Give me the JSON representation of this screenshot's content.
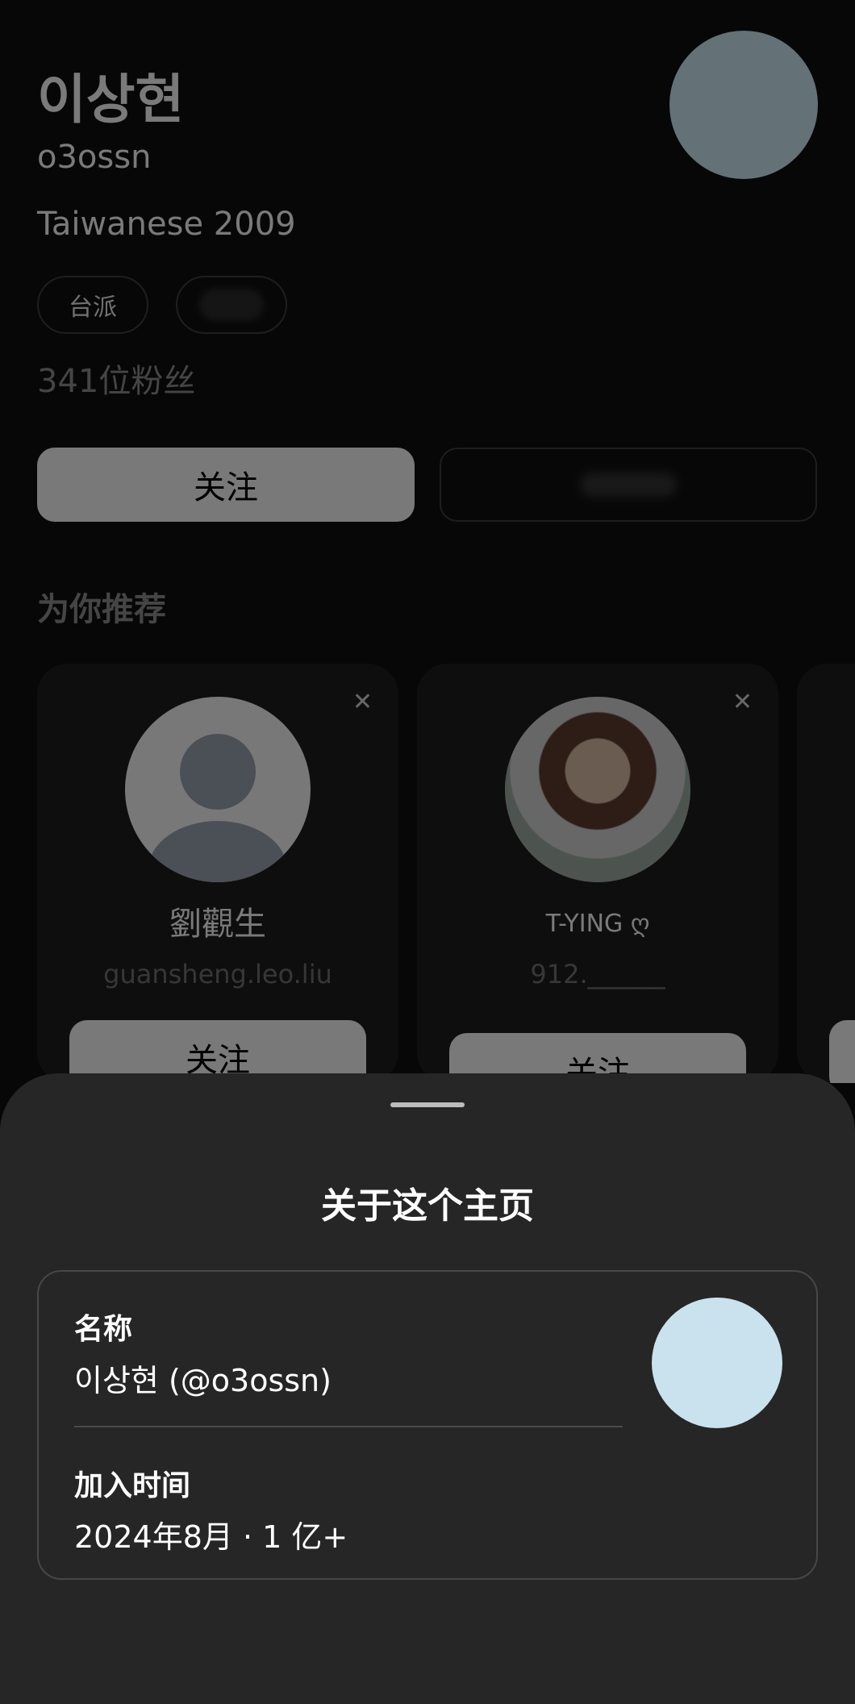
{
  "profile": {
    "name": "이상현",
    "handle": "o3ossn",
    "bio": "Taiwanese 2009",
    "tags": [
      "台派"
    ],
    "followers": "341位粉丝",
    "follow_label": "关注",
    "recommend_title": "为你推荐"
  },
  "recommendations": [
    {
      "name": "劉觀生",
      "sub": "guansheng.leo.liu",
      "follow_label": "关注",
      "close_icon": "close-icon"
    },
    {
      "name": "T-YING ღ",
      "sub": "912.______",
      "follow_label": "关注",
      "close_icon": "close-icon"
    }
  ],
  "sheet": {
    "title": "关于这个主页",
    "name_label": "名称",
    "name_value": "이상현 (@o3ossn)",
    "joined_label": "加入时间",
    "joined_value": "2024年8月 · 1 亿+"
  },
  "colors": {
    "avatar_fill": "#c9e2ee",
    "sheet_bg": "#262626",
    "button_bg": "#f2f2f2"
  }
}
